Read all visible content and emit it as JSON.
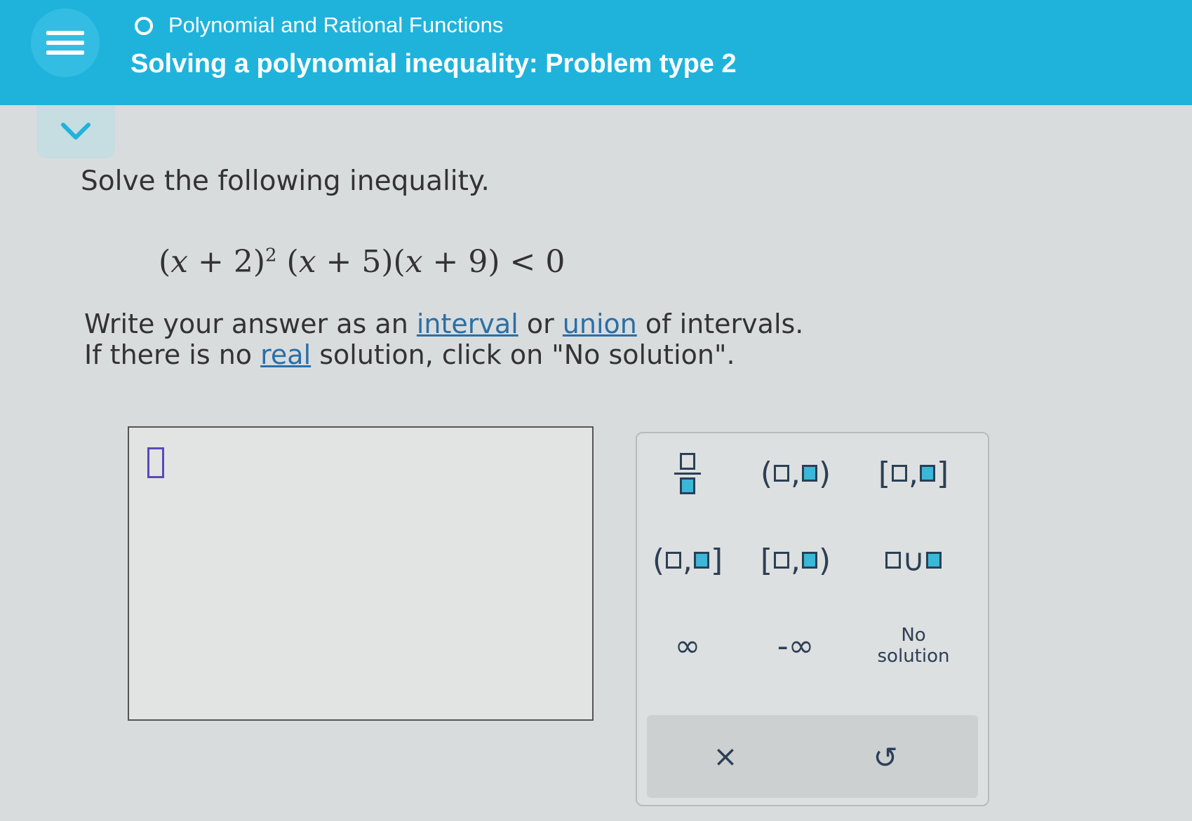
{
  "header": {
    "topic": "Polynomial and Rational Functions",
    "title": "Solving a polynomial inequality: Problem type 2"
  },
  "problem": {
    "prompt": "Solve the following inequality.",
    "instruction_line1_part1": "Write your answer as an ",
    "link_interval": "interval",
    "instruction_or": " or ",
    "link_union": "union",
    "instruction_line1_part2": " of intervals.",
    "instruction_line2_part1": "If there is no ",
    "link_real": "real",
    "instruction_line2_part2": " solution, click on \"No solution\"."
  },
  "keypad": {
    "infinity": "∞",
    "neg_infinity": "-∞",
    "no_solution_line1": "No",
    "no_solution_line2": "solution",
    "clear": "×",
    "undo": "↺"
  },
  "colors": {
    "header_bg": "#1fb3dc",
    "accent_teal": "#3bb7d8",
    "link": "#2a6fa8"
  }
}
